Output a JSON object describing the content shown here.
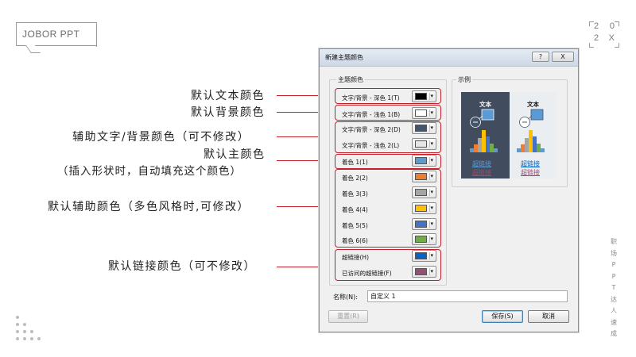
{
  "logo": {
    "text": "JOBOR PPT"
  },
  "year": {
    "line1": [
      "2",
      "0"
    ],
    "line2": [
      "2",
      "X"
    ]
  },
  "side_text": [
    "职",
    "场",
    "P",
    "P",
    "T",
    "达",
    "人",
    "速",
    "成"
  ],
  "annotations": {
    "text_dark1": "默认文本颜色",
    "text_light1": "默认背景颜色",
    "aux_text_bg": "辅助文字/背景颜色（可不修改）",
    "main_color": "默认主颜色",
    "main_color_note": "（插入形状时，自动填充这个颜色）",
    "aux_colors": "默认辅助颜色（多色风格时,可修改）",
    "link_colors": "默认链接颜色（可不修改）"
  },
  "dialog": {
    "title": "新建主题颜色",
    "help_button": "?",
    "close_button": "X",
    "theme_colors_group": "主题颜色",
    "sample_group": "示例",
    "rows": [
      {
        "label": "文字/背景 - 深色 1(T)",
        "color": "#000000"
      },
      {
        "label": "文字/背景 - 浅色 1(B)",
        "color": "#ffffff"
      },
      {
        "label": "文字/背景 - 深色 2(D)",
        "color": "#44546a"
      },
      {
        "label": "文字/背景 - 浅色 2(L)",
        "color": "#e7e6e6"
      },
      {
        "label": "着色 1(1)",
        "color": "#5b9bd5"
      },
      {
        "label": "着色 2(2)",
        "color": "#ed7d31"
      },
      {
        "label": "着色 3(3)",
        "color": "#a5a5a5"
      },
      {
        "label": "着色 4(4)",
        "color": "#ffc000"
      },
      {
        "label": "着色 5(5)",
        "color": "#4472c4"
      },
      {
        "label": "着色 6(6)",
        "color": "#70ad47"
      },
      {
        "label": "超链接(H)",
        "color": "#0563c1"
      },
      {
        "label": "已访问的超链接(F)",
        "color": "#954f72"
      }
    ],
    "preview": {
      "text_label": "文本",
      "hyperlink": "超链接",
      "visited_hyperlink": "超链接"
    },
    "name_label": "名称(N):",
    "name_value": "自定义 1",
    "reset_button": "重置(R)",
    "save_button": "保存(S)",
    "cancel_button": "取消"
  }
}
